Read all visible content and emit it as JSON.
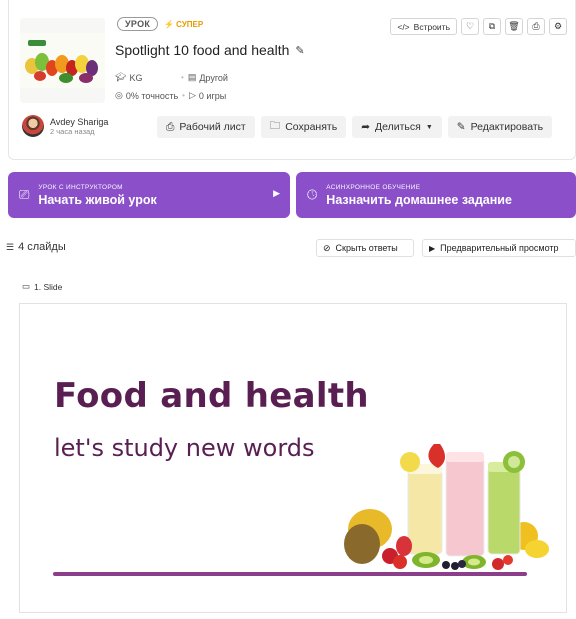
{
  "header": {
    "badge_lesson": "УРОК",
    "badge_super": "СУПЕР",
    "title": "Spotlight 10 food and health",
    "grade": "KG",
    "subject": "Другой",
    "accuracy": "0% точность",
    "plays": "0 игры",
    "embed_label": "Встроить"
  },
  "author": {
    "name": "Avdey Shariga",
    "time": "2 часа назад"
  },
  "actions": {
    "worksheet": "Рабочий лист",
    "save": "Сохранять",
    "share": "Делиться",
    "edit": "Редактировать"
  },
  "live": {
    "small": "УРОК С ИНСТРУКТОРОМ",
    "big": "Начать живой урок"
  },
  "async": {
    "small": "АСИНХРОННОЕ ОБУЧЕНИЕ",
    "big": "Назначить домашнее задание"
  },
  "slides": {
    "count": "4 слайды",
    "hide_answers": "Скрыть ответы",
    "preview": "Предварительный просмотр"
  },
  "slide1": {
    "label": "1. Slide",
    "title": "Food and health",
    "subtitle": "let's study new words"
  },
  "colors": {
    "accent": "#8b4fc9",
    "slide_text": "#5a1f52",
    "super": "#e89b00"
  }
}
